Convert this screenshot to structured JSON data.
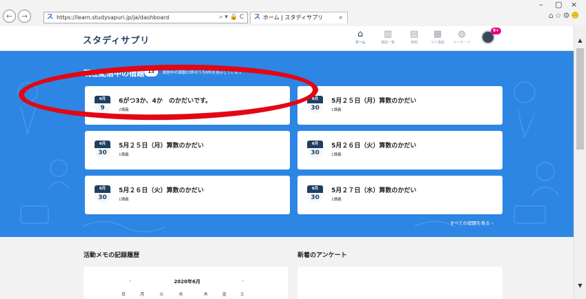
{
  "browser": {
    "url": "https://learn.studysapuri.jp/ja/dashboard",
    "addr_tools": "⌕ ▾ 🔒 C",
    "tab_title": "ホーム | スタディサプリ",
    "favicon": "ス",
    "tab_close": "×",
    "win_min": "–",
    "win_max": "▢",
    "win_close": "×",
    "back": "←",
    "forward": "→",
    "toolbar_icons": "⌂☆⚙"
  },
  "header": {
    "logo": "スタディサプリ",
    "nav": [
      {
        "label": "ホーム",
        "icon": "home-icon"
      },
      {
        "label": "講座一覧",
        "icon": "courses-icon"
      },
      {
        "label": "宿題",
        "icon": "homework-icon"
      },
      {
        "label": "マイ講座",
        "icon": "my-courses-icon"
      },
      {
        "label": "メッセージ",
        "icon": "message-icon"
      }
    ],
    "badge": "9+"
  },
  "homework": {
    "title": "現在配信中の宿題",
    "count": "13",
    "subtitle": "配信中の宿題13件のうち6件を表示しています",
    "see_all": "すべての宿題を見る ›",
    "cards": [
      {
        "month": "6月",
        "day": "9",
        "title": "6がつ3か、4か　のかだいです。",
        "meta": "2講義"
      },
      {
        "month": "6月",
        "day": "30",
        "title": "5月２５日（月）算数のかだい",
        "meta": "1講義"
      },
      {
        "month": "6月",
        "day": "30",
        "title": "5月２５日（月）算数のかだい",
        "meta": "1講義"
      },
      {
        "month": "6月",
        "day": "30",
        "title": "5月２６日（火）算数のかだい",
        "meta": "1講義"
      },
      {
        "month": "6月",
        "day": "30",
        "title": "5月２６日（火）算数のかだい",
        "meta": "1講義"
      },
      {
        "month": "6月",
        "day": "30",
        "title": "5月２７日（水）算数のかだい",
        "meta": "1講義"
      }
    ]
  },
  "activity": {
    "title": "活動メモの記録履歴",
    "calendar_month": "2020年6月",
    "prev": "‹",
    "next": "›",
    "weekdays": [
      "日",
      "月",
      "火",
      "水",
      "木",
      "金",
      "土"
    ]
  },
  "survey": {
    "title": "新着のアンケート"
  },
  "colors": {
    "accent": "#2d86e3",
    "highlight": "#e30613",
    "navy": "#1f3e62"
  }
}
